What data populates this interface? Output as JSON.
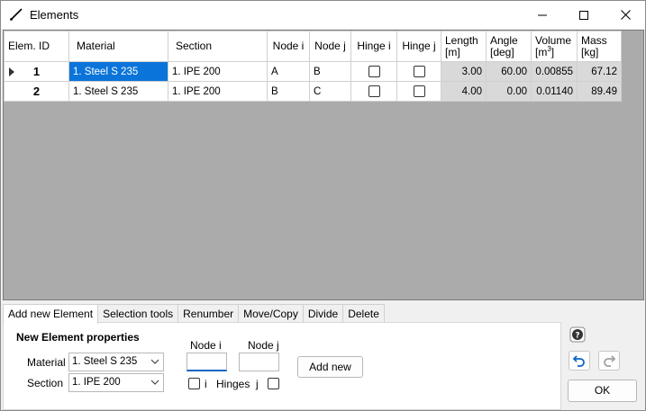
{
  "window": {
    "title": "Elements",
    "icon": "line-element-icon"
  },
  "grid": {
    "columns": [
      {
        "label": "Elem. ID"
      },
      {
        "label": "Material"
      },
      {
        "label": "Section"
      },
      {
        "label": "Node i"
      },
      {
        "label": "Node j"
      },
      {
        "label": "Hinge i"
      },
      {
        "label": "Hinge j"
      },
      {
        "label": "Length",
        "unit": "[m]"
      },
      {
        "label": "Angle",
        "unit": "[deg]"
      },
      {
        "label": "Volume",
        "unit": "[m",
        "unit_sup": "3",
        "unit_end": "]"
      },
      {
        "label": "Mass",
        "unit": "[kg]"
      }
    ],
    "rows": [
      {
        "id": "1",
        "material": "1. Steel S 235",
        "section": "1. IPE 200",
        "node_i": "A",
        "node_j": "B",
        "hinge_i": false,
        "hinge_j": false,
        "length": "3.00",
        "angle": "60.00",
        "volume": "0.00855",
        "mass": "67.12",
        "current": true
      },
      {
        "id": "2",
        "material": "1. Steel S 235",
        "section": "1. IPE 200",
        "node_i": "B",
        "node_j": "C",
        "hinge_i": false,
        "hinge_j": false,
        "length": "4.00",
        "angle": "0.00",
        "volume": "0.01140",
        "mass": "89.49",
        "current": false
      }
    ]
  },
  "tabs": [
    {
      "label": "Add new Element",
      "active": true
    },
    {
      "label": "Selection tools"
    },
    {
      "label": "Renumber"
    },
    {
      "label": "Move/Copy"
    },
    {
      "label": "Divide"
    },
    {
      "label": "Delete"
    }
  ],
  "panel": {
    "title": "New Element properties",
    "material_label": "Material",
    "material_value": "1. Steel S 235",
    "section_label": "Section",
    "section_value": "1. IPE 200",
    "node_i_label": "Node i",
    "node_j_label": "Node j",
    "hinge_i_label": "i",
    "hinges_label": "Hinges",
    "hinge_j_label": "j",
    "add_button": "Add new"
  },
  "side": {
    "ok_label": "OK"
  },
  "colors": {
    "selection": "#0a74da",
    "computed_cell": "#d9d9d9",
    "grid_background": "#ababab"
  }
}
